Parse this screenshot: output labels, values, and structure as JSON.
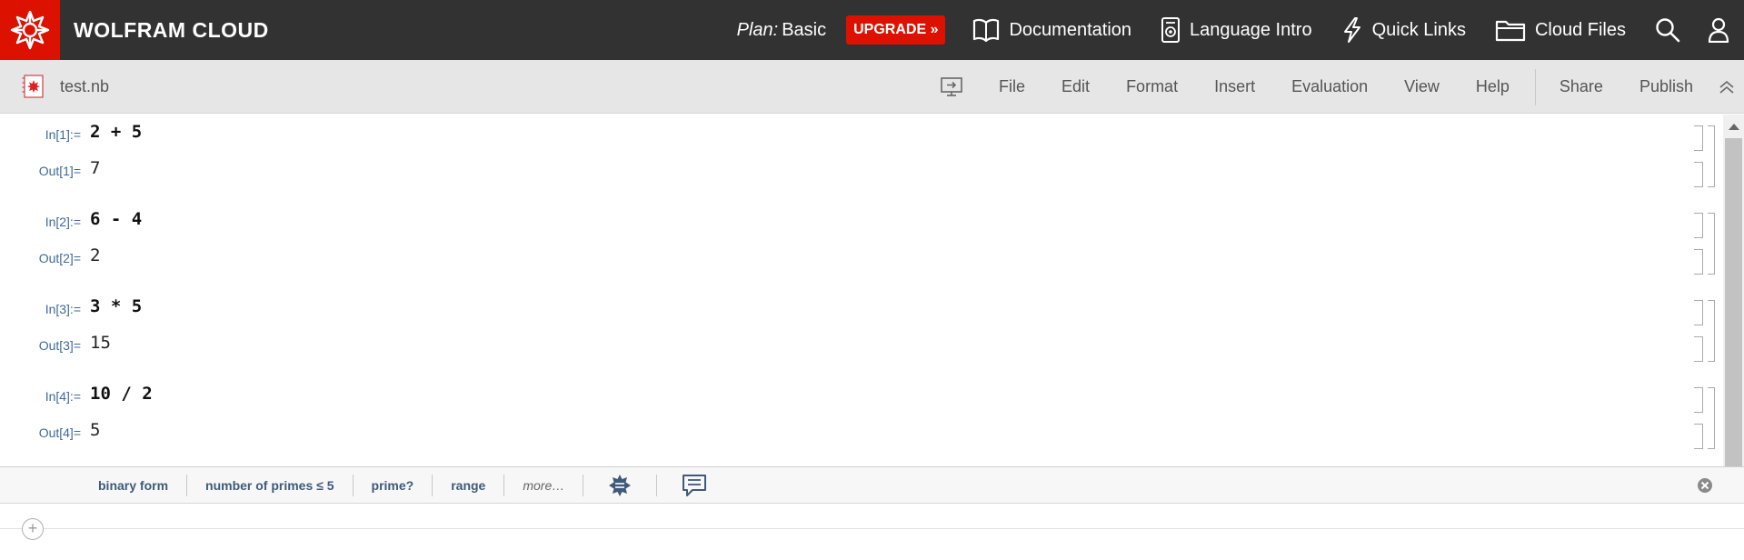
{
  "app": {
    "brand": "WOLFRAM CLOUD"
  },
  "topbar": {
    "plan_label": "Plan:",
    "plan_value": "Basic",
    "upgrade_label": "UPGRADE »",
    "nav": [
      {
        "label": "Documentation",
        "icon": "book-icon"
      },
      {
        "label": "Language Intro",
        "icon": "notebook-icon"
      },
      {
        "label": "Quick Links",
        "icon": "lightning-icon"
      },
      {
        "label": "Cloud Files",
        "icon": "folder-icon"
      }
    ]
  },
  "toolbar": {
    "notebook_name": "test.nb",
    "menu": [
      "File",
      "Edit",
      "Format",
      "Insert",
      "Evaluation",
      "View",
      "Help"
    ],
    "share_label": "Share",
    "publish_label": "Publish"
  },
  "cells": [
    {
      "in_label": "In[1]:=",
      "input": "2 + 5",
      "out_label": "Out[1]=",
      "output": "7"
    },
    {
      "in_label": "In[2]:=",
      "input": "6 - 4",
      "out_label": "Out[2]=",
      "output": "2"
    },
    {
      "in_label": "In[3]:=",
      "input": "3 * 5",
      "out_label": "Out[3]=",
      "output": "15"
    },
    {
      "in_label": "In[4]:=",
      "input": "10 / 2",
      "out_label": "Out[4]=",
      "output": "5"
    }
  ],
  "suggestions": {
    "items": [
      "binary form",
      "number of primes ≤ 5",
      "prime?",
      "range"
    ],
    "more_label": "more…"
  },
  "colors": {
    "brand_red": "#dd1100",
    "topbar_bg": "#323232",
    "label_blue": "#3f6a9a",
    "suggestion_text": "#3f5a78"
  }
}
